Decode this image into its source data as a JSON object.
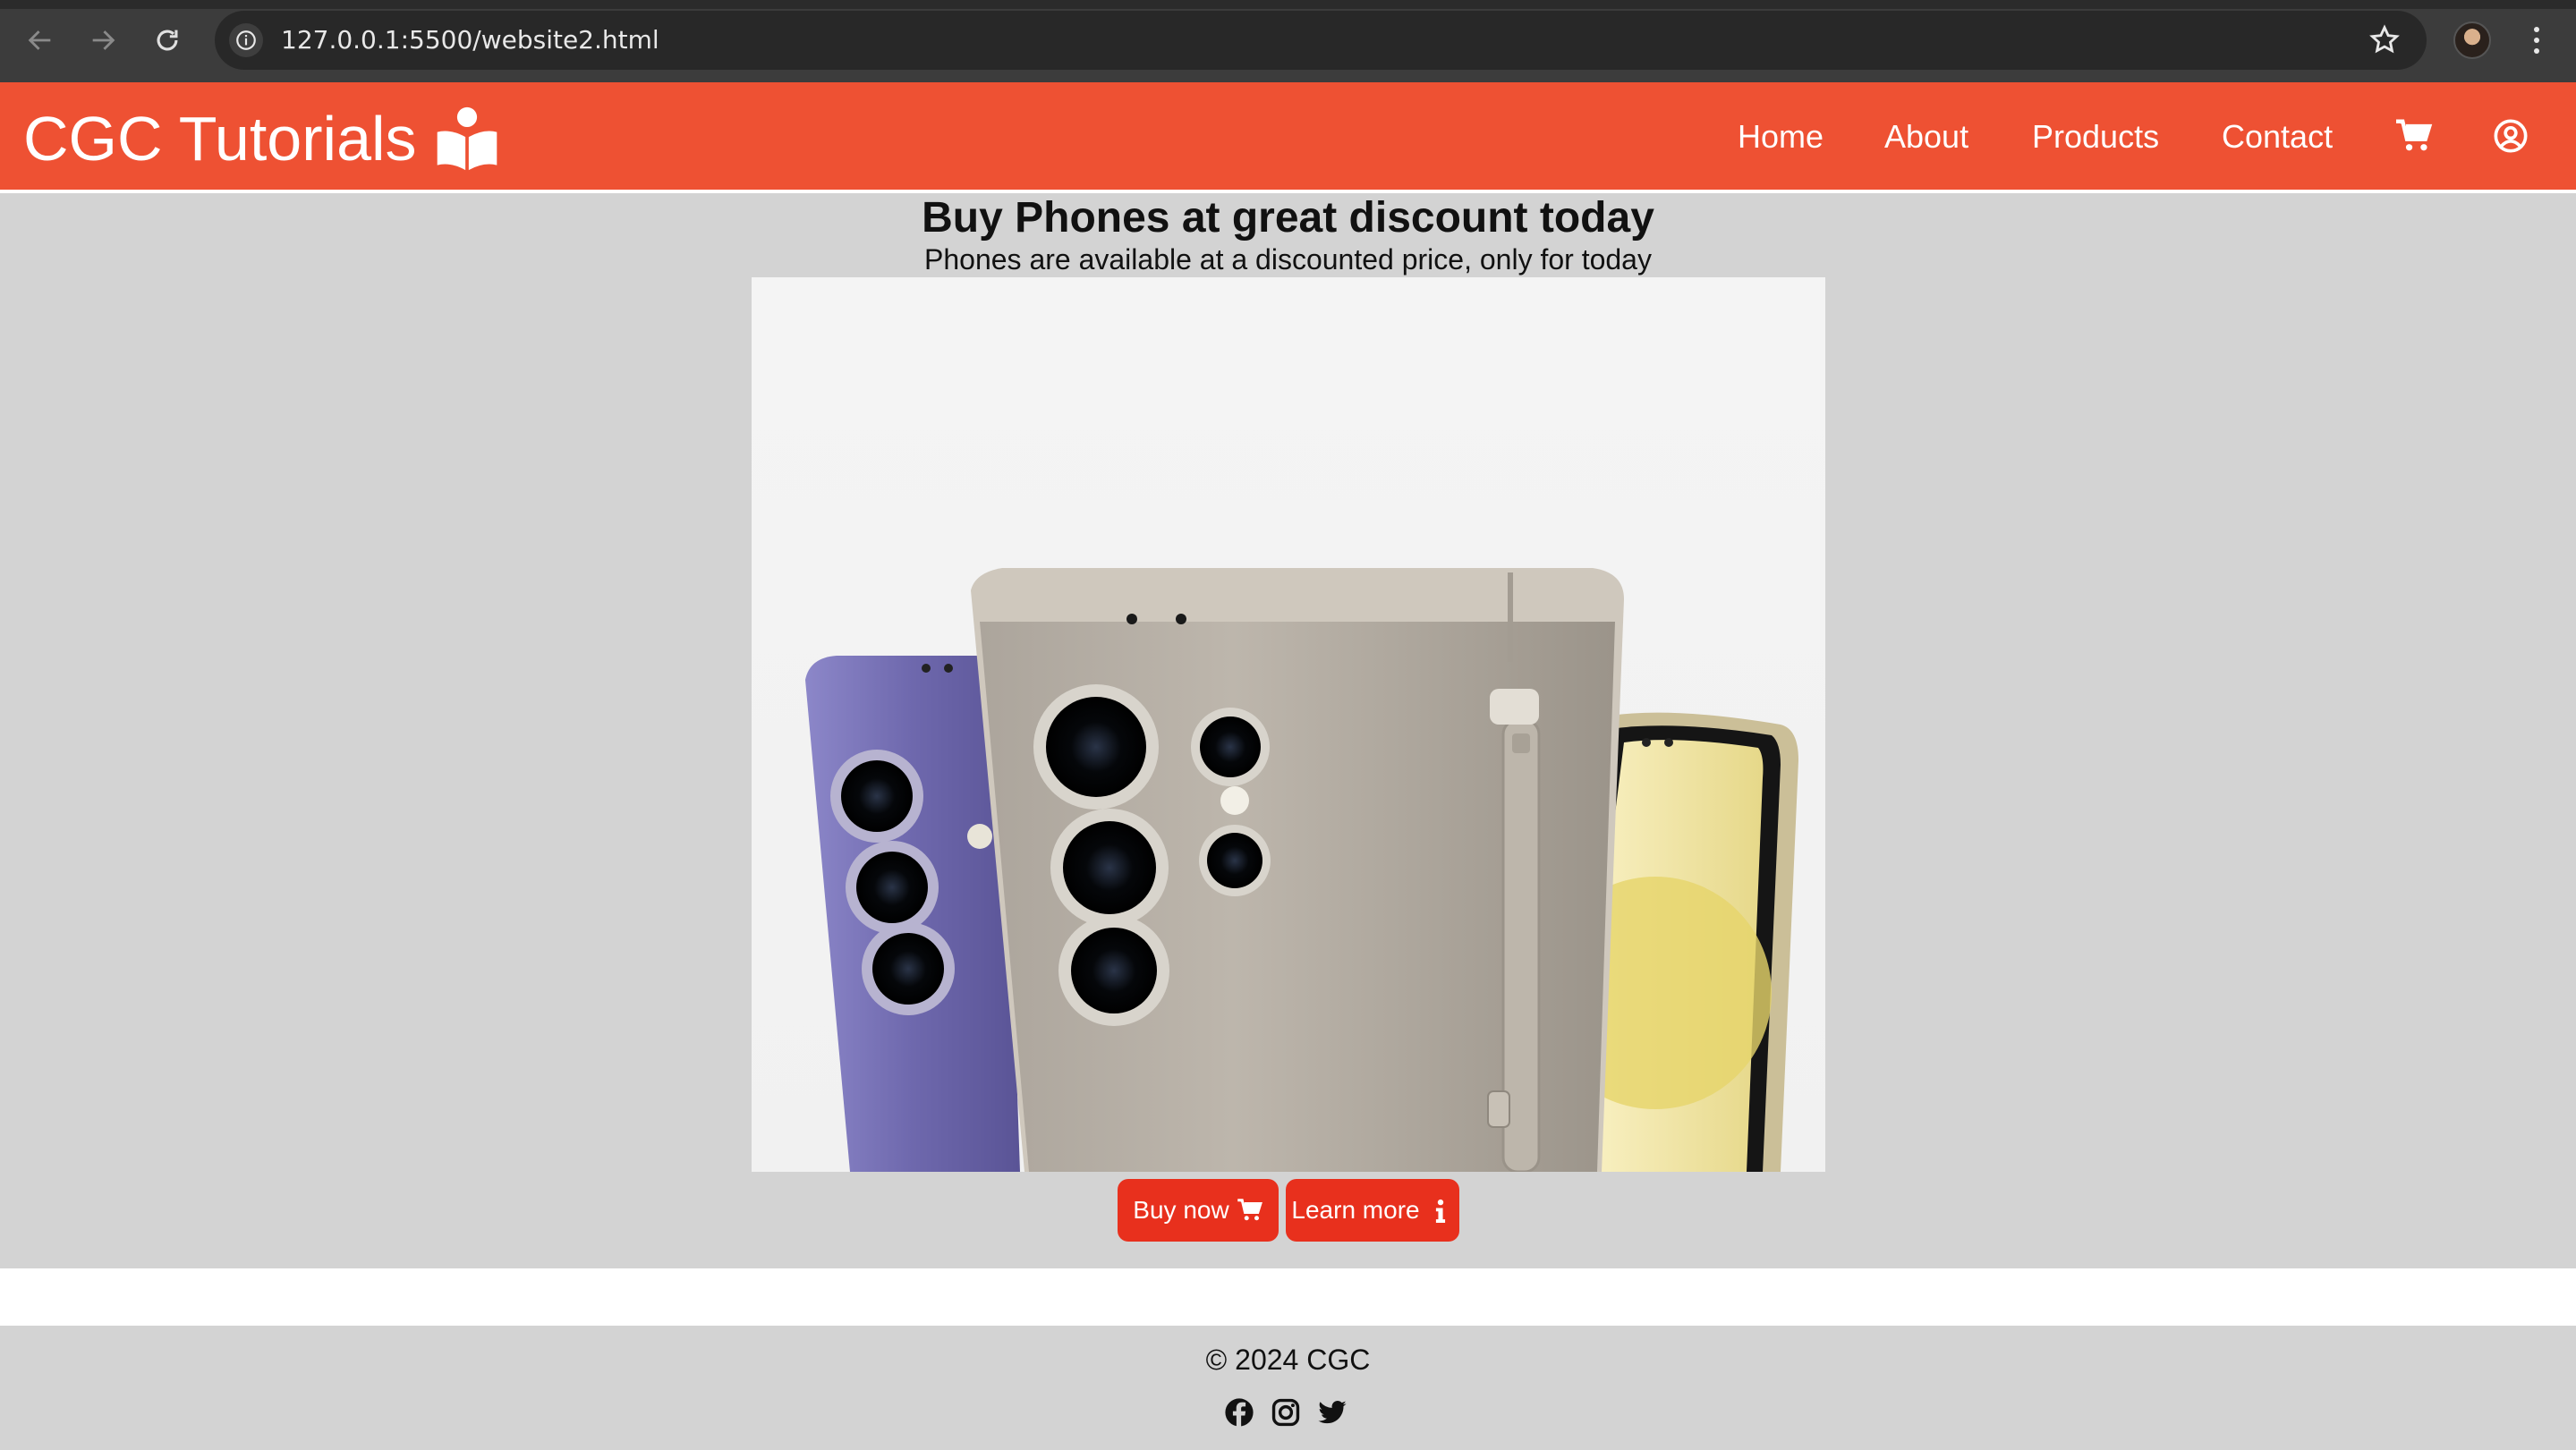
{
  "browser": {
    "url": "127.0.0.1:5500/website2.html"
  },
  "header": {
    "brand": "CGC Tutorials",
    "brand_icon": "book-reader-icon",
    "nav": [
      "Home",
      "About",
      "Products",
      "Contact"
    ],
    "icons": [
      "cart-icon",
      "user-circle-icon"
    ]
  },
  "hero": {
    "title": "Buy Phones at great discount today",
    "subtitle": "Phones are available at a discounted price, only for today",
    "image": "phones-image"
  },
  "actions": {
    "buy_label": "Buy now",
    "buy_icon": "cart-icon",
    "learn_label": "Learn more",
    "learn_icon": "info-icon"
  },
  "footer": {
    "copyright": "© 2024 CGC",
    "socials": [
      "facebook-icon",
      "instagram-icon",
      "twitter-icon"
    ]
  },
  "colors": {
    "accent": "#ee5133",
    "button": "#e8301d",
    "background": "#d3d3d3"
  }
}
